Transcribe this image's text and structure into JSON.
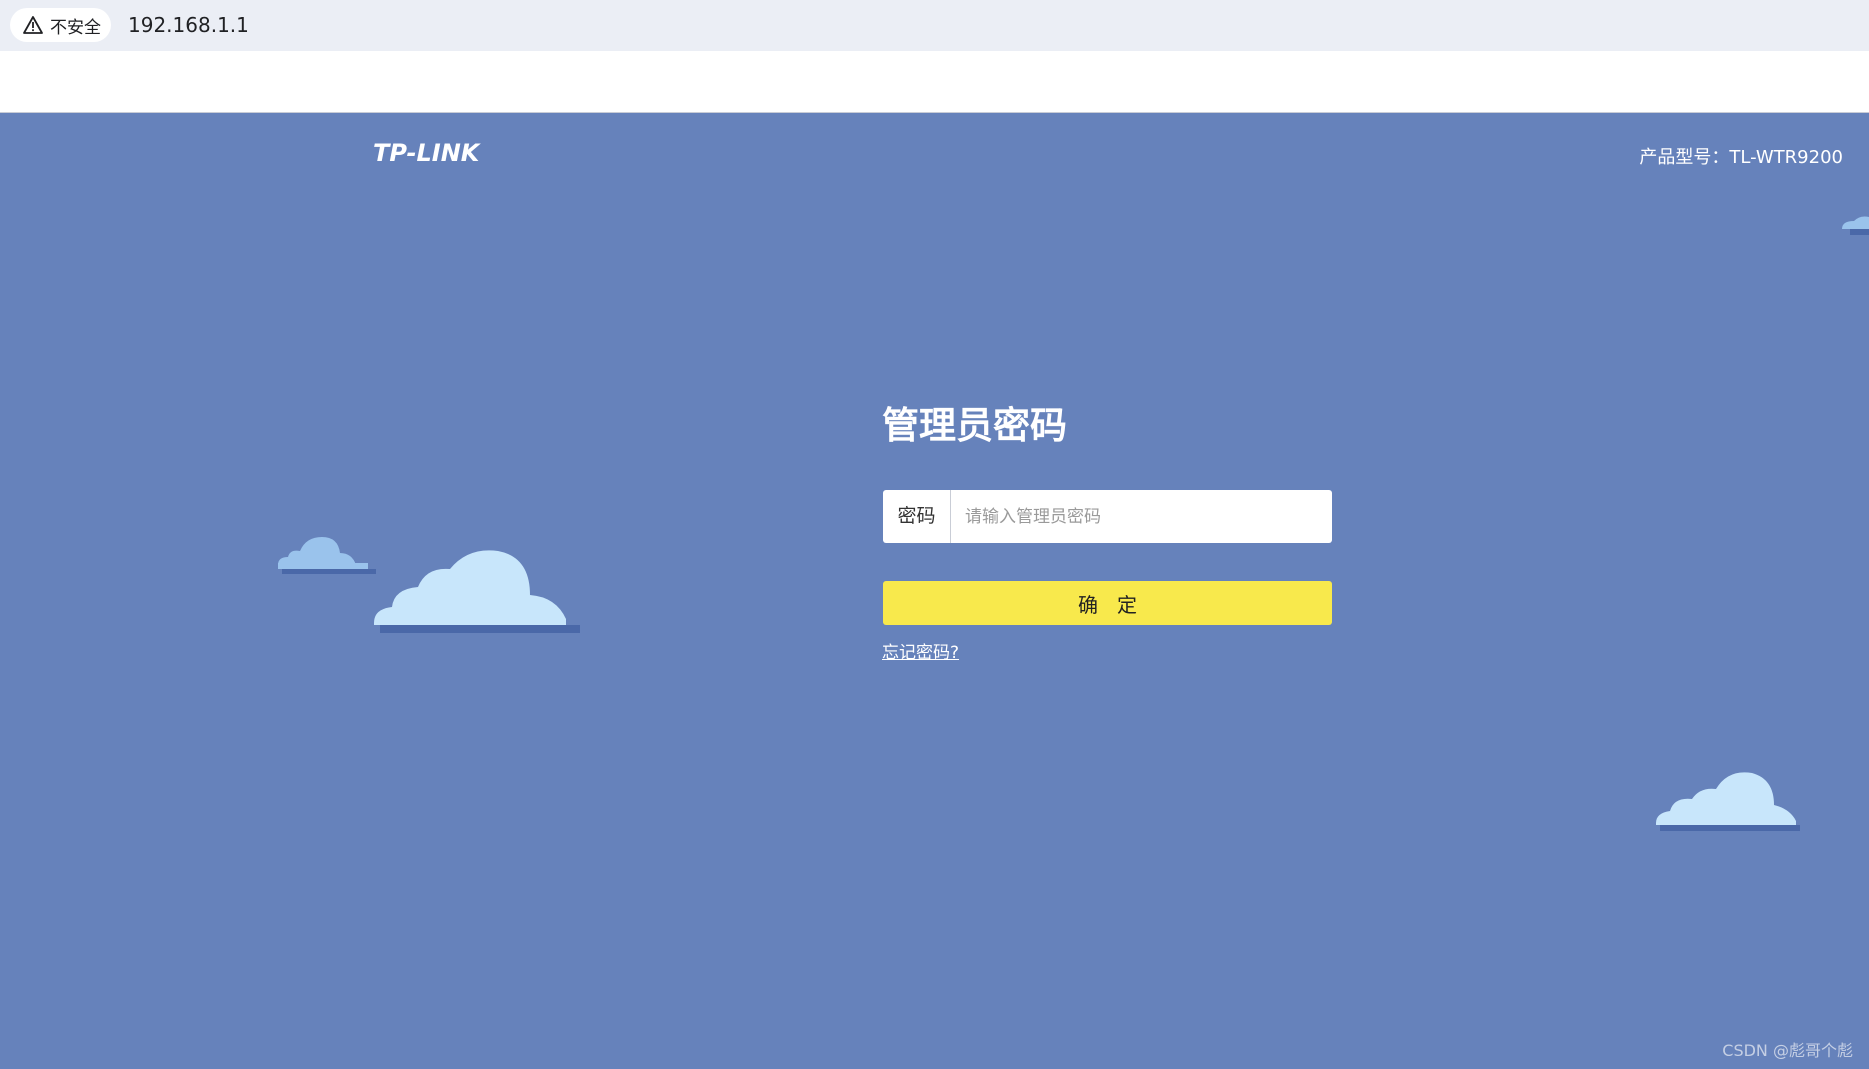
{
  "browser": {
    "security_label": "不安全",
    "url": "192.168.1.1"
  },
  "header": {
    "logo_text": "TP-LINK",
    "model_text": "产品型号：TL-WTR9200"
  },
  "login": {
    "title": "管理员密码",
    "password_label": "密码",
    "password_placeholder": "请输入管理员密码",
    "password_value": "",
    "confirm_label": "确   定",
    "forgot_link": "忘记密码?"
  },
  "footer": {
    "watermark": "CSDN @彪哥个彪"
  },
  "colors": {
    "page_background": "#6682bb",
    "confirm_button": "#f8e94c",
    "cloud_light": "#c8e6fb",
    "cloud_mid": "#9ac3ec",
    "cloud_shadow": "#4a68a8"
  },
  "icons": {
    "security": "warning-triangle-icon"
  }
}
